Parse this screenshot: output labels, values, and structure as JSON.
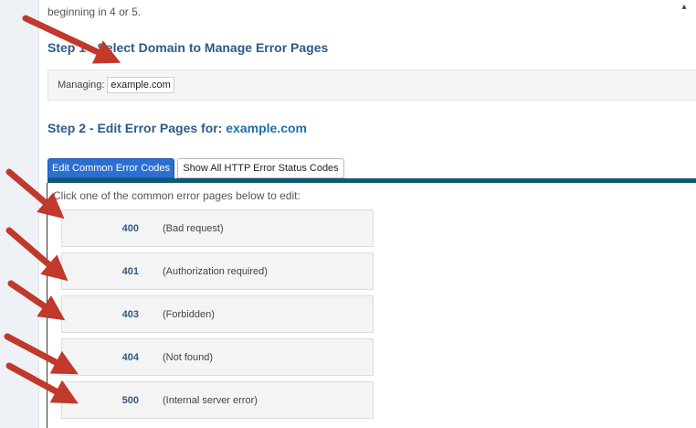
{
  "intro": {
    "text": "beginning in 4 or 5."
  },
  "step1": {
    "title": "Step 1 - Select Domain to Manage Error Pages"
  },
  "managing": {
    "label": "Managing:",
    "domain": "example.com"
  },
  "step2": {
    "title_prefix": "Step 2 - Edit Error Pages for:",
    "domain": "example.com"
  },
  "tabs": [
    {
      "label": "Edit Common Error Codes",
      "active": true
    },
    {
      "label": "Show All HTTP Error Status Codes",
      "active": false
    }
  ],
  "panel": {
    "hint": "Click one of the common error pages below to edit:"
  },
  "error_pages": [
    {
      "code": "400",
      "description": "(Bad request)"
    },
    {
      "code": "401",
      "description": "(Authorization required)"
    },
    {
      "code": "403",
      "description": "(Forbidden)"
    },
    {
      "code": "404",
      "description": "(Not found)"
    },
    {
      "code": "500",
      "description": "(Internal server error)"
    }
  ],
  "colors": {
    "heading": "#2d5a87",
    "active_tab": "#2c6fd0",
    "tab_bar": "#0f5a73",
    "annotation_arrow": "#c0392b"
  },
  "scroll_icon": "chevron-up-icon"
}
